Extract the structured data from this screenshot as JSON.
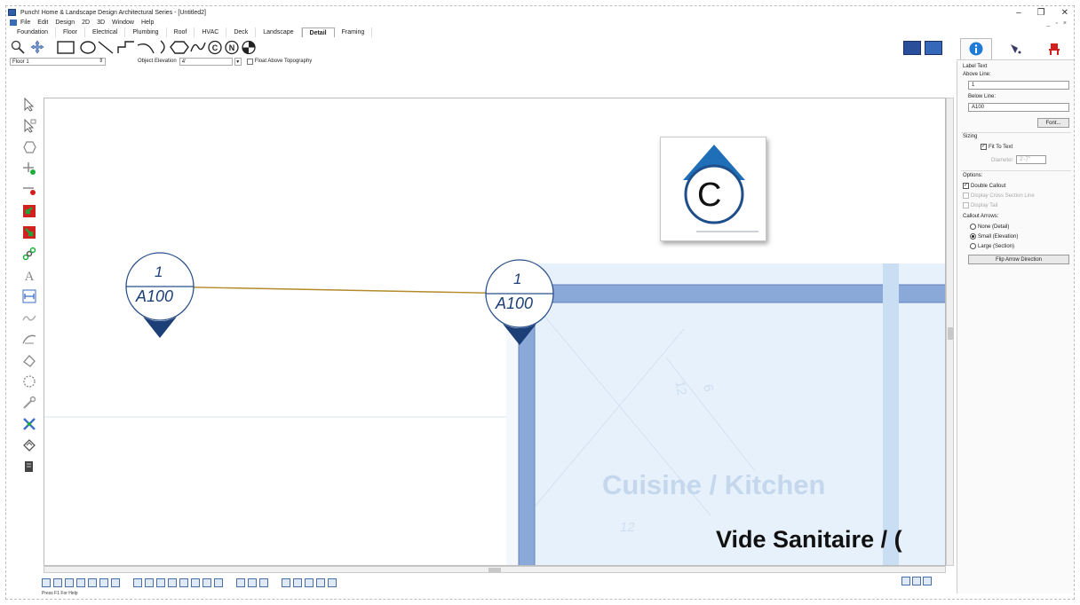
{
  "window": {
    "title": "Punch! Home & Landscape Design Architectural Series - [Untitled2]",
    "minimize": "–",
    "restore": "❐",
    "close": "✕",
    "doc_min": "_",
    "doc_restore": "▫",
    "doc_close": "×"
  },
  "menu": [
    "File",
    "Edit",
    "Design",
    "2D",
    "3D",
    "Window",
    "Help"
  ],
  "tabs": [
    "Foundation",
    "Floor",
    "Electrical",
    "Plumbing",
    "Roof",
    "HVAC",
    "Deck",
    "Landscape",
    "Detail",
    "Framing"
  ],
  "active_tab": "Detail",
  "options_bar": {
    "floor": "Floor 1",
    "elevation_label": "Object Elevation",
    "elevation_value": "4'",
    "float_label": "Float Above Topography"
  },
  "canvas": {
    "callouts": [
      {
        "top": "1",
        "bottom": "A100"
      },
      {
        "top": "1",
        "bottom": "A100"
      }
    ],
    "preview_letter": "C",
    "room_dim_a": "12",
    "room_dim_b": "6",
    "room_dim_c": "12",
    "room_name": "Cuisine / Kitchen",
    "room_name_2": "Vide Sanitaire / ("
  },
  "status": "Press F1 For Help",
  "panel": {
    "label_text": "Label Text",
    "above_line_label": "Above Line:",
    "above_line_value": "1",
    "below_line_label": "Below Line:",
    "below_line_value": "A100",
    "font_button": "Font...",
    "sizing_label": "Sizing",
    "fit_to_text": "Fit To Text",
    "diameter_label": "Diameter",
    "diameter_value": "2'-7\"",
    "options_label": "Options:",
    "double_callout": "Double Callout",
    "display_cross": "Display Cross Section Line",
    "display_tail": "Display Tail",
    "callout_arrows": "Callout Arrows:",
    "arrow_none": "None (Detail)",
    "arrow_small": "Small (Elevation)",
    "arrow_large": "Large (Section)",
    "flip_button": "Flip Arrow Direction"
  },
  "colors": {
    "accent": "#1c3f78",
    "wall": "#8aa8d8",
    "room_fill": "#e8f2fb",
    "info_blue": "#1f7bd6",
    "red_tool": "#d22020"
  }
}
